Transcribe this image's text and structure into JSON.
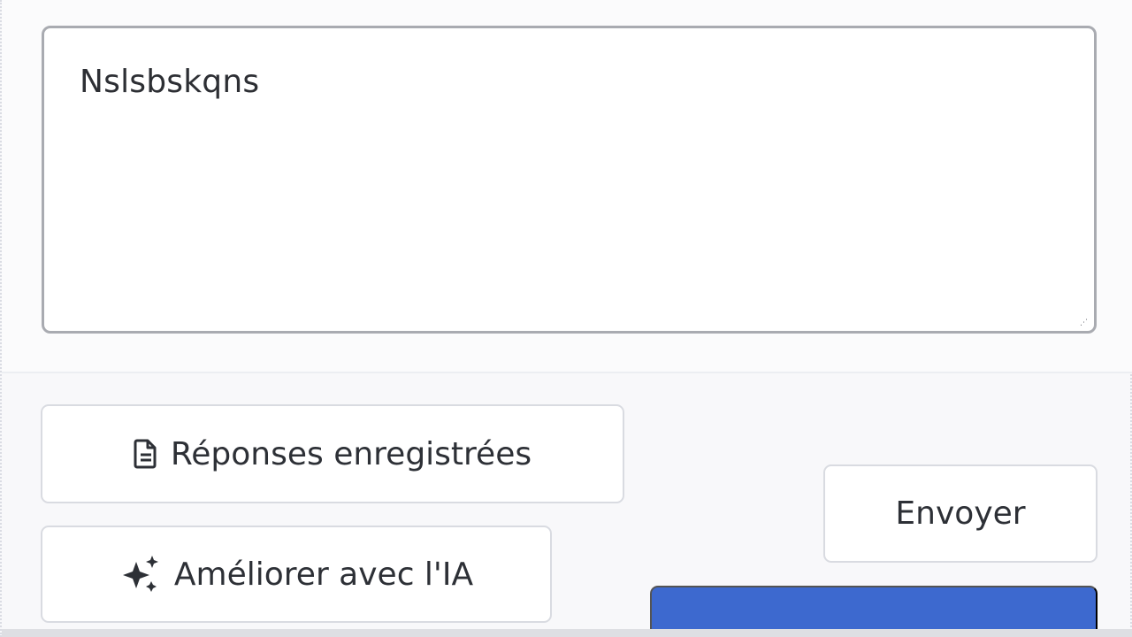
{
  "composer": {
    "message_value": "Nslsbskqns",
    "resize_glyph": "⋰"
  },
  "actions": {
    "saved_responses": {
      "label": "Réponses enregistrées",
      "icon": "document-icon"
    },
    "improve_with_ai": {
      "label": "Améliorer avec l'IA",
      "icon": "sparkle-icon"
    },
    "send": {
      "label": "Envoyer"
    },
    "primary_partial": {
      "label": "",
      "color": "#3d69cf"
    }
  },
  "colors": {
    "background": "#f8f8fa",
    "field_border": "#a9abb1",
    "button_border": "#d9dbe1",
    "text": "#2d3036",
    "accent": "#3d69cf"
  }
}
